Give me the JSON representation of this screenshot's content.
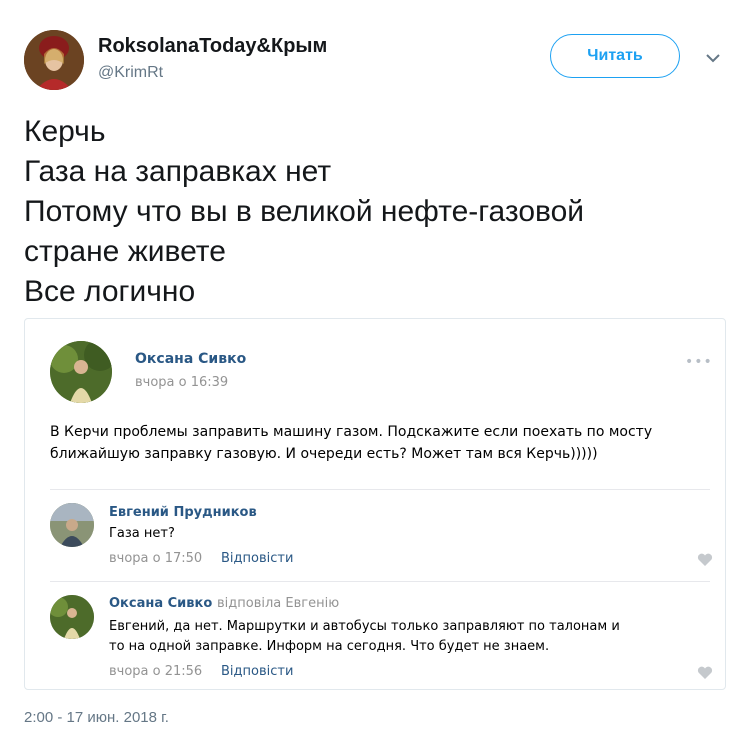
{
  "tweet": {
    "author_name": "RoksolanaToday&Крым",
    "author_handle": "@KrimRt",
    "follow_label": "Читать",
    "text_lines": [
      "Керчь",
      "Газа на заправках нет",
      "Потому что вы в великой нефте-газовой",
      "стране живете",
      "Все логично"
    ],
    "date": "2:00 - 17 июн. 2018 г."
  },
  "post": {
    "author": "Оксана Сивко",
    "time": "вчора о 16:39",
    "dots": "•••",
    "text_lines": [
      "В Керчи проблемы заправить машину газом. Подскажите если поехать по мосту",
      "ближайшую заправку газовую. И очереди есть? Может там вся Керчь)))))"
    ]
  },
  "comments": [
    {
      "author": "Евгений Прудников",
      "replied_to": "",
      "text_lines": [
        "Газа нет?"
      ],
      "time": "вчора о 17:50",
      "reply_label": "Відповісти"
    },
    {
      "author": "Оксана Сивко",
      "replied_to": "відповіла Евгенію",
      "text_lines": [
        "Евгений, да нет. Маршрутки и автобусы только заправляют по талонам и",
        "то на одной заправке. Информ на сегодня. Что будет не знаем."
      ],
      "time": "вчора о 21:56",
      "reply_label": "Відповісти"
    }
  ],
  "colors": {
    "twitter_blue": "#1da1f2",
    "vk_link": "#2a5885",
    "muted": "#939393"
  }
}
